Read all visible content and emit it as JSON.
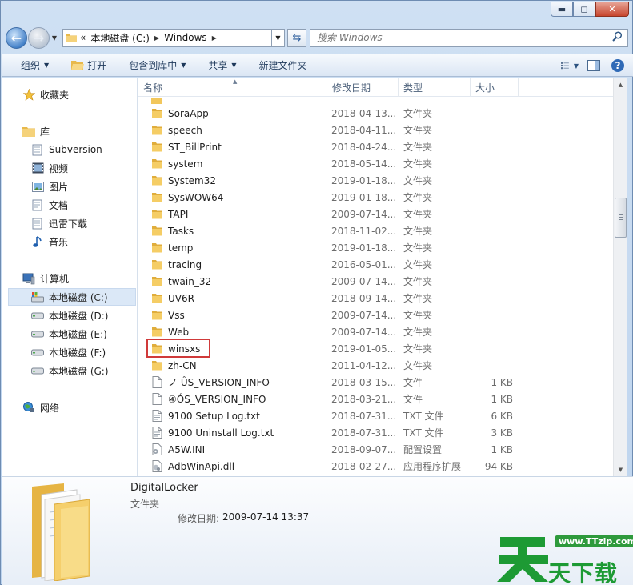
{
  "window": {
    "min_label": "▬",
    "max_label": "◻",
    "close_label": "✕"
  },
  "nav": {
    "address_segments": [
      "«",
      "本地磁盘 (C:)",
      "Windows"
    ],
    "search_placeholder": "搜索 Windows"
  },
  "toolbar": {
    "organize": "组织",
    "open": "打开",
    "include_library": "包含到库中",
    "share": "共享",
    "new_folder": "新建文件夹"
  },
  "sidebar": {
    "favorites": "收藏夹",
    "libraries": "库",
    "libs": [
      "Subversion",
      "视频",
      "图片",
      "文档",
      "迅雷下载",
      "音乐"
    ],
    "computer": "计算机",
    "drives": [
      "本地磁盘 (C:)",
      "本地磁盘 (D:)",
      "本地磁盘 (E:)",
      "本地磁盘 (F:)",
      "本地磁盘 (G:)"
    ],
    "network": "网络"
  },
  "columns": {
    "name": "名称",
    "date": "修改日期",
    "type": "类型",
    "size": "大小"
  },
  "files": [
    {
      "name": "SoraApp",
      "date": "2018-04-13...",
      "type": "文件夹",
      "size": "",
      "kind": "folder"
    },
    {
      "name": "speech",
      "date": "2018-04-11...",
      "type": "文件夹",
      "size": "",
      "kind": "folder"
    },
    {
      "name": "ST_BillPrint",
      "date": "2018-04-24...",
      "type": "文件夹",
      "size": "",
      "kind": "folder"
    },
    {
      "name": "system",
      "date": "2018-05-14...",
      "type": "文件夹",
      "size": "",
      "kind": "folder"
    },
    {
      "name": "System32",
      "date": "2019-01-18...",
      "type": "文件夹",
      "size": "",
      "kind": "folder"
    },
    {
      "name": "SysWOW64",
      "date": "2019-01-18...",
      "type": "文件夹",
      "size": "",
      "kind": "folder"
    },
    {
      "name": "TAPI",
      "date": "2009-07-14...",
      "type": "文件夹",
      "size": "",
      "kind": "folder"
    },
    {
      "name": "Tasks",
      "date": "2018-11-02...",
      "type": "文件夹",
      "size": "",
      "kind": "folder"
    },
    {
      "name": "temp",
      "date": "2019-01-18...",
      "type": "文件夹",
      "size": "",
      "kind": "folder"
    },
    {
      "name": "tracing",
      "date": "2016-05-01...",
      "type": "文件夹",
      "size": "",
      "kind": "folder"
    },
    {
      "name": "twain_32",
      "date": "2009-07-14...",
      "type": "文件夹",
      "size": "",
      "kind": "folder"
    },
    {
      "name": "UV6R",
      "date": "2018-09-14...",
      "type": "文件夹",
      "size": "",
      "kind": "folder"
    },
    {
      "name": "Vss",
      "date": "2009-07-14...",
      "type": "文件夹",
      "size": "",
      "kind": "folder"
    },
    {
      "name": "Web",
      "date": "2009-07-14...",
      "type": "文件夹",
      "size": "",
      "kind": "folder"
    },
    {
      "name": "winsxs",
      "date": "2019-01-05...",
      "type": "文件夹",
      "size": "",
      "kind": "folder"
    },
    {
      "name": "zh-CN",
      "date": "2011-04-12...",
      "type": "文件夹",
      "size": "",
      "kind": "folder"
    },
    {
      "name": "ノ ÛS_VERSION_INFO",
      "date": "2018-03-15...",
      "type": "文件",
      "size": "1 KB",
      "kind": "file"
    },
    {
      "name": "④ÓS_VERSION_INFO",
      "date": "2018-03-21...",
      "type": "文件",
      "size": "1 KB",
      "kind": "file"
    },
    {
      "name": "9100 Setup Log.txt",
      "date": "2018-07-31...",
      "type": "TXT 文件",
      "size": "6 KB",
      "kind": "txt"
    },
    {
      "name": "9100 Uninstall Log.txt",
      "date": "2018-07-31...",
      "type": "TXT 文件",
      "size": "3 KB",
      "kind": "txt"
    },
    {
      "name": "A5W.INI",
      "date": "2018-09-07...",
      "type": "配置设置",
      "size": "1 KB",
      "kind": "ini"
    },
    {
      "name": "AdbWinApi.dll",
      "date": "2018-02-27...",
      "type": "应用程序扩展",
      "size": "94 KB",
      "kind": "dll"
    }
  ],
  "details": {
    "name": "DigitalLocker",
    "type": "文件夹",
    "date_label": "修改日期:",
    "date_value": "2009-07-14 13:37"
  },
  "watermark": {
    "url": "www.TTzip.com",
    "text": "天下载"
  },
  "colors": {
    "folder": "#f2c75c",
    "highlight": "#d03a3a",
    "selection": "#dbe8f7",
    "watermark": "#1d9a34"
  }
}
